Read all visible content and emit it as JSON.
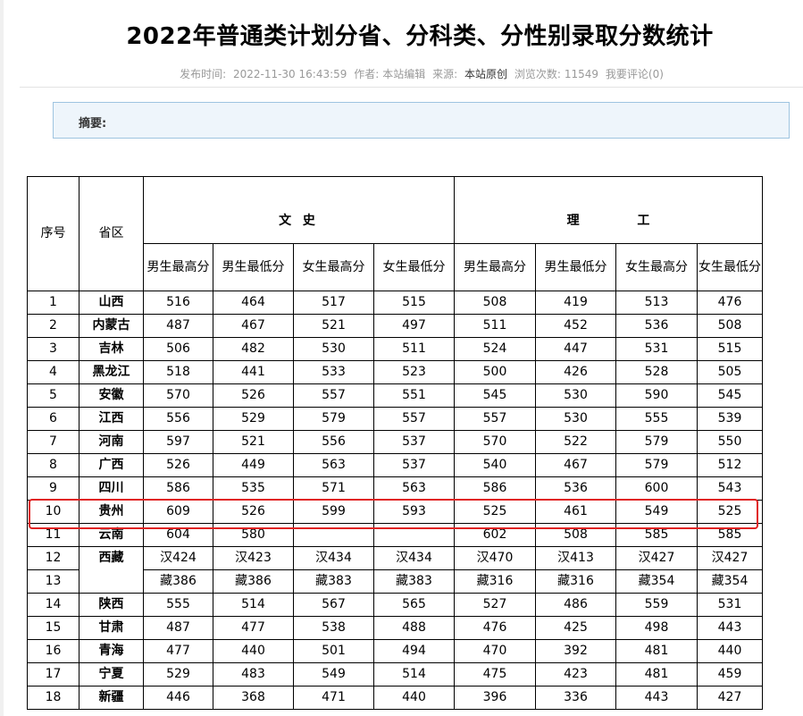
{
  "article": {
    "title": "2022年普通类计划分省、分科类、分性别录取分数统计",
    "meta": {
      "publish_label": "发布时间:",
      "publish_time": "2022-11-30 16:43:59",
      "author_label": "作者:",
      "author": "本站编辑",
      "source_label": "来源:",
      "source": "本站原创",
      "views_label": "浏览次数:",
      "views": "11549",
      "comment_link": "我要评论(0)"
    },
    "summary_label": "摘要:"
  },
  "table": {
    "col_index": "序号",
    "col_province": "省区",
    "group_wenshi": "文 史",
    "group_ligong": "理 工",
    "sub_headers": {
      "wenshi": [
        "男生最高分",
        "男生最低分",
        "女生最高分",
        "女生最低分"
      ],
      "ligong": [
        "男生最高分",
        "男生最低分",
        "女生最高分",
        "女生最低分"
      ]
    },
    "rows": [
      {
        "idx": "1",
        "prov": "山西",
        "v": [
          "516",
          "464",
          "517",
          "515",
          "508",
          "419",
          "513",
          "476"
        ]
      },
      {
        "idx": "2",
        "prov": "内蒙古",
        "v": [
          "487",
          "467",
          "521",
          "497",
          "511",
          "452",
          "536",
          "508"
        ]
      },
      {
        "idx": "3",
        "prov": "吉林",
        "v": [
          "506",
          "482",
          "530",
          "511",
          "524",
          "447",
          "531",
          "515"
        ]
      },
      {
        "idx": "4",
        "prov": "黑龙江",
        "v": [
          "518",
          "441",
          "533",
          "523",
          "500",
          "426",
          "528",
          "505"
        ]
      },
      {
        "idx": "5",
        "prov": "安徽",
        "v": [
          "570",
          "526",
          "557",
          "551",
          "545",
          "530",
          "590",
          "545"
        ]
      },
      {
        "idx": "6",
        "prov": "江西",
        "v": [
          "556",
          "529",
          "579",
          "557",
          "557",
          "530",
          "555",
          "539"
        ]
      },
      {
        "idx": "7",
        "prov": "河南",
        "v": [
          "597",
          "521",
          "556",
          "537",
          "570",
          "522",
          "579",
          "550"
        ]
      },
      {
        "idx": "8",
        "prov": "广西",
        "v": [
          "526",
          "449",
          "563",
          "537",
          "540",
          "467",
          "579",
          "512"
        ]
      },
      {
        "idx": "9",
        "prov": "四川",
        "v": [
          "586",
          "535",
          "571",
          "563",
          "586",
          "536",
          "600",
          "543"
        ]
      },
      {
        "idx": "10",
        "prov": "贵州",
        "v": [
          "609",
          "526",
          "599",
          "593",
          "525",
          "461",
          "549",
          "525"
        ]
      },
      {
        "idx": "11",
        "prov": "云南",
        "v": [
          "604",
          "580",
          "",
          "",
          "602",
          "508",
          "585",
          "585"
        ]
      },
      {
        "idx": "12",
        "prov": "西藏",
        "v": [
          "汉424",
          "汉423",
          "汉434",
          "汉434",
          "汉470",
          "汉413",
          "汉427",
          "汉427"
        ]
      },
      {
        "idx": "13",
        "prov": "",
        "v": [
          "藏386",
          "藏386",
          "藏383",
          "藏383",
          "藏316",
          "藏316",
          "藏354",
          "藏354"
        ]
      },
      {
        "idx": "14",
        "prov": "陕西",
        "v": [
          "555",
          "514",
          "567",
          "565",
          "527",
          "486",
          "559",
          "531"
        ]
      },
      {
        "idx": "15",
        "prov": "甘肃",
        "v": [
          "487",
          "477",
          "538",
          "488",
          "476",
          "425",
          "498",
          "443"
        ]
      },
      {
        "idx": "16",
        "prov": "青海",
        "v": [
          "477",
          "440",
          "501",
          "494",
          "470",
          "392",
          "481",
          "440"
        ]
      },
      {
        "idx": "17",
        "prov": "宁夏",
        "v": [
          "529",
          "483",
          "549",
          "514",
          "475",
          "423",
          "481",
          "459"
        ]
      },
      {
        "idx": "18",
        "prov": "新疆",
        "v": [
          "446",
          "368",
          "471",
          "440",
          "396",
          "336",
          "443",
          "427"
        ]
      }
    ]
  },
  "colors": {
    "highlight_border": "#e02020",
    "summary_bg": "#eef5fb",
    "summary_border": "#9ec4e0",
    "meta_text": "#999999"
  }
}
